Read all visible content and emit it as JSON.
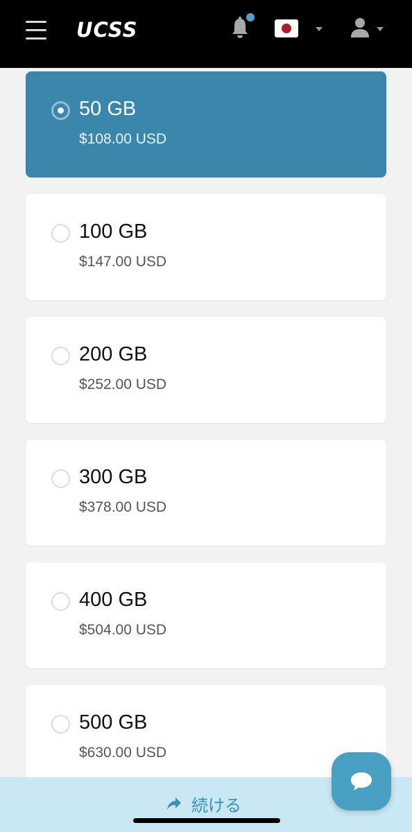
{
  "header": {
    "logo": "UCSS",
    "notification_badge": true,
    "language_flag": "japan-flag-icon",
    "accent_color": "#4aa3c8"
  },
  "plans": [
    {
      "size": "50 GB",
      "price": "$108.00 USD",
      "selected": true
    },
    {
      "size": "100 GB",
      "price": "$147.00 USD",
      "selected": false
    },
    {
      "size": "200 GB",
      "price": "$252.00 USD",
      "selected": false
    },
    {
      "size": "300 GB",
      "price": "$378.00 USD",
      "selected": false
    },
    {
      "size": "400 GB",
      "price": "$504.00 USD",
      "selected": false
    },
    {
      "size": "500 GB",
      "price": "$630.00 USD",
      "selected": false
    }
  ],
  "footer": {
    "continue_label": "続ける",
    "continue_icon": "share-arrow-icon",
    "chat_icon": "chat-bubble-icon"
  },
  "colors": {
    "selected_plan_bg": "#3b87ab",
    "bottom_bar_bg": "#c9e8f4",
    "header_bg": "#000000"
  }
}
